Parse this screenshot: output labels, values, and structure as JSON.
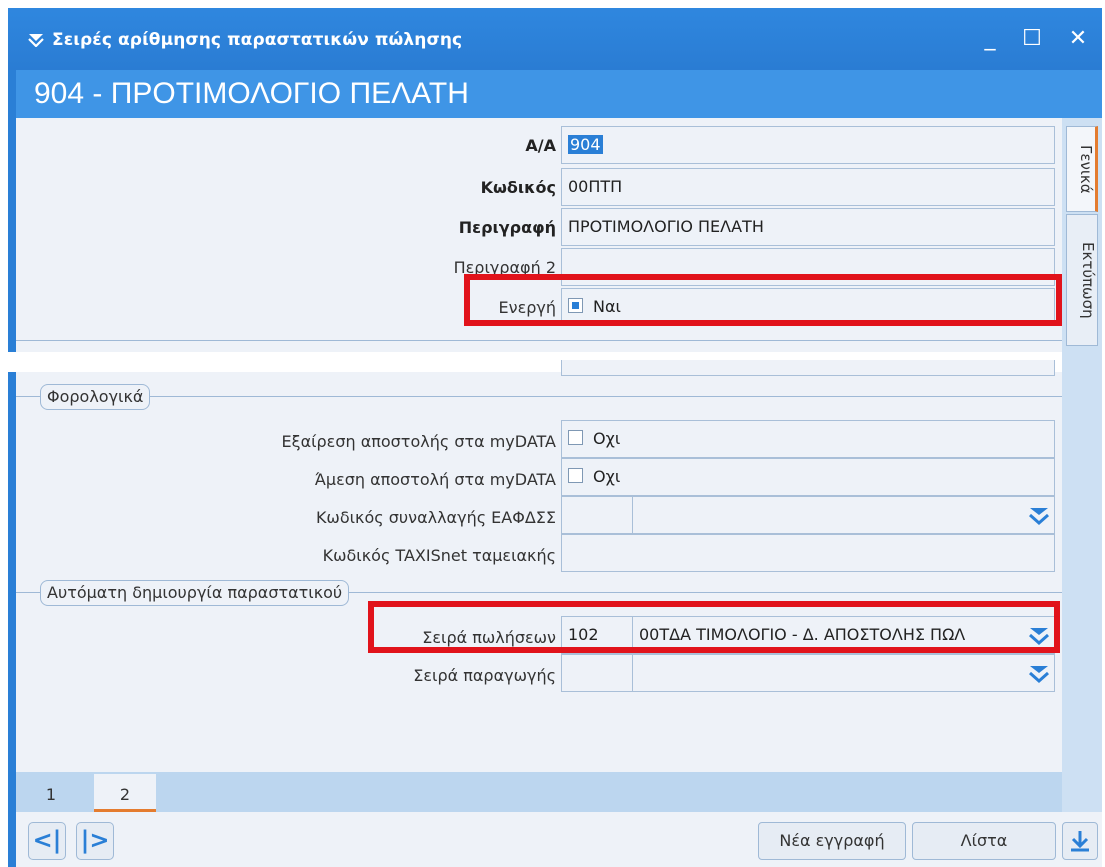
{
  "window": {
    "title": "Σειρές αρίθμησης παραστατικών πώλησης",
    "header": "904 - ΠΡΟΤΙΜΟΛΟΓΙΟ ΠΕΛΑΤΗ"
  },
  "side_tabs": [
    "Γενικά",
    "Εκτύπωση"
  ],
  "general": {
    "aa_label": "Α/Α",
    "aa_value": "904",
    "code_label": "Κωδικός",
    "code_value": "00ΠΤΠ",
    "desc_label": "Περιγραφή",
    "desc_value": "ΠΡΟΤΙΜΟΛΟΓΙΟ ΠΕΛΑΤΗ",
    "desc2_label": "Περιγραφή 2",
    "desc2_value": "",
    "active_label": "Ενεργή",
    "active_value": "Ναι"
  },
  "tax": {
    "group_label": "Φορολογικά",
    "mydata_exclude_label": "Εξαίρεση αποστολής στα myDATA",
    "mydata_exclude_value": "Οχι",
    "mydata_direct_label": "Άμεση αποστολή στα myDATA",
    "mydata_direct_value": "Οχι",
    "eafdss_label": "Κωδικός συναλλαγής ΕΑΦΔΣΣ",
    "eafdss_code": "",
    "eafdss_desc": "",
    "taxisnet_label": "Κωδικός TAXISnet ταμειακής",
    "taxisnet_value": ""
  },
  "auto": {
    "group_label": "Αυτόματη δημιουργία παραστατικού",
    "sales_series_label": "Σειρά πωλήσεων",
    "sales_series_code": "102",
    "sales_series_desc": "00ΤΔΑ ΤΙΜΟΛΟΓΙΟ - Δ. ΑΠΟΣΤΟΛΗΣ ΠΩΛ",
    "production_series_label": "Σειρά παραγωγής",
    "production_series_code": "",
    "production_series_desc": ""
  },
  "page_tabs": [
    "1",
    "2"
  ],
  "buttons": {
    "new_record": "Νέα εγγραφή",
    "list": "Λίστα"
  },
  "colors": {
    "accent": "#2a7fd6",
    "highlight_box": "#e1131b",
    "active_tab_underline": "#e47c2f"
  }
}
